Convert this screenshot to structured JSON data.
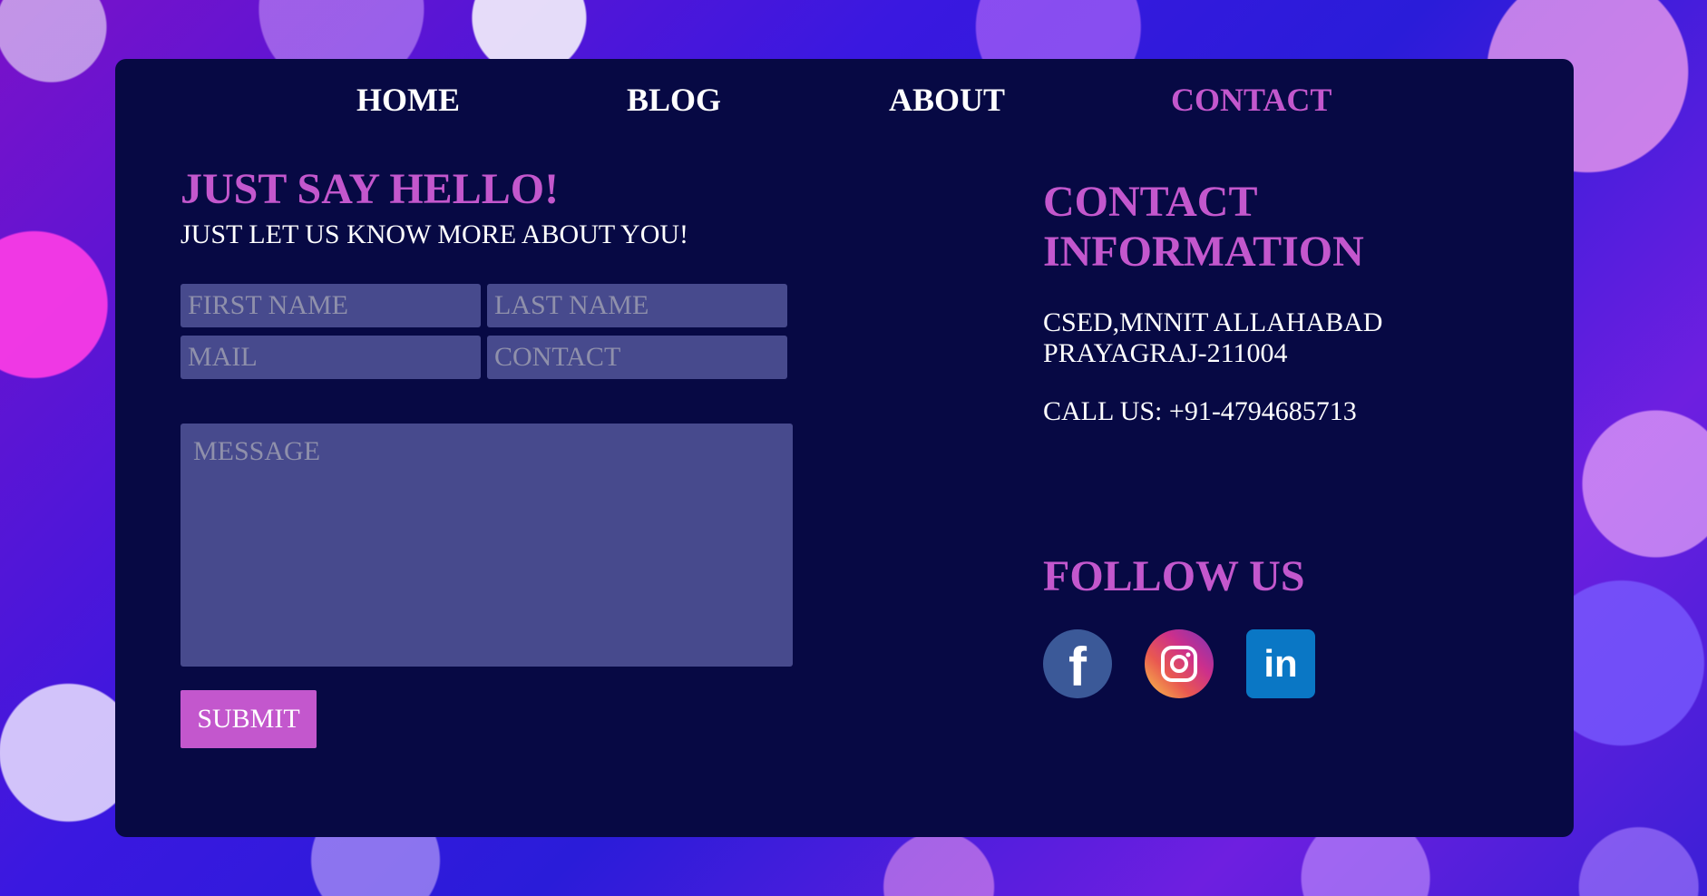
{
  "nav": {
    "items": [
      "HOME",
      "BLOG",
      "ABOUT",
      "CONTACT"
    ],
    "active": "CONTACT"
  },
  "form": {
    "title": "JUST SAY HELLO!",
    "subtitle": "JUST LET US KNOW MORE ABOUT YOU!",
    "first_name_placeholder": "FIRST NAME",
    "last_name_placeholder": "LAST NAME",
    "mail_placeholder": "MAIL",
    "contact_placeholder": "CONTACT",
    "message_placeholder": "MESSAGE",
    "submit_label": "SUBMIT"
  },
  "info": {
    "title_line1": "CONTACT",
    "title_line2": "INFORMATION",
    "address_line1": "CSED,MNNIT ALLAHABAD",
    "address_line2": "PRAYAGRAJ-211004",
    "phone": "CALL US: +91-4794685713",
    "follow_title": "FOLLOW US",
    "social": [
      {
        "name": "facebook-icon",
        "glyph": "f"
      },
      {
        "name": "instagram-icon",
        "glyph": ""
      },
      {
        "name": "linkedin-icon",
        "glyph": "in"
      }
    ]
  },
  "colors": {
    "accent": "#c357cd",
    "panel": "#070944",
    "field": "#474a8d",
    "text": "#ffffff"
  }
}
